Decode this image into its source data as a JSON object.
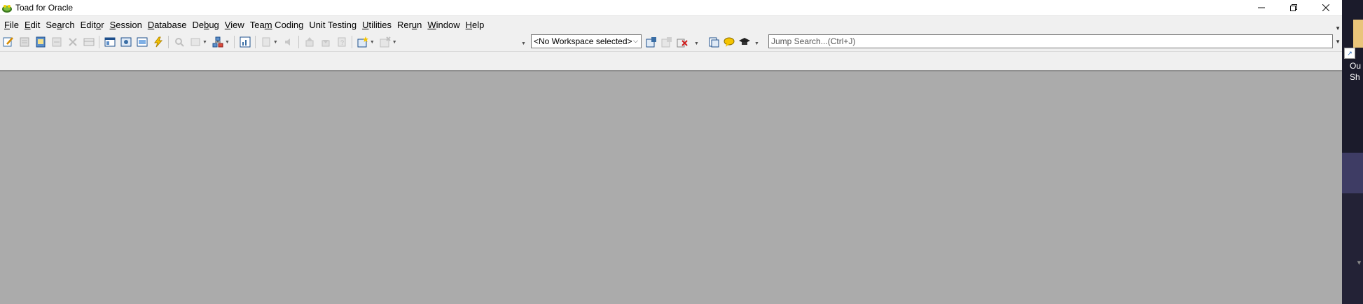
{
  "window": {
    "title": "Toad for Oracle",
    "controls": [
      "minimize-icon",
      "restore-icon",
      "close-icon"
    ]
  },
  "menu": [
    {
      "pre": "",
      "u": "F",
      "post": "ile"
    },
    {
      "pre": "",
      "u": "E",
      "post": "dit"
    },
    {
      "pre": "Se",
      "u": "a",
      "post": "rch"
    },
    {
      "pre": "Edit",
      "u": "o",
      "post": "r"
    },
    {
      "pre": "",
      "u": "S",
      "post": "ession"
    },
    {
      "pre": "",
      "u": "D",
      "post": "atabase"
    },
    {
      "pre": "De",
      "u": "b",
      "post": "ug"
    },
    {
      "pre": "",
      "u": "V",
      "post": "iew"
    },
    {
      "pre": "Tea",
      "u": "m",
      "post": " Coding"
    },
    {
      "pre": "Unit Testing",
      "u": "",
      "post": ""
    },
    {
      "pre": "",
      "u": "U",
      "post": "tilities"
    },
    {
      "pre": "Rer",
      "u": "u",
      "post": "n"
    },
    {
      "pre": "",
      "u": "W",
      "post": "indow"
    },
    {
      "pre": "",
      "u": "H",
      "post": "elp"
    }
  ],
  "toolbar": {
    "workspace_select": "<No Workspace selected>",
    "jump_search_placeholder": "Jump Search...(Ctrl+J)"
  },
  "desktop": {
    "label_line1": "Ou",
    "label_line2": "Sh"
  }
}
